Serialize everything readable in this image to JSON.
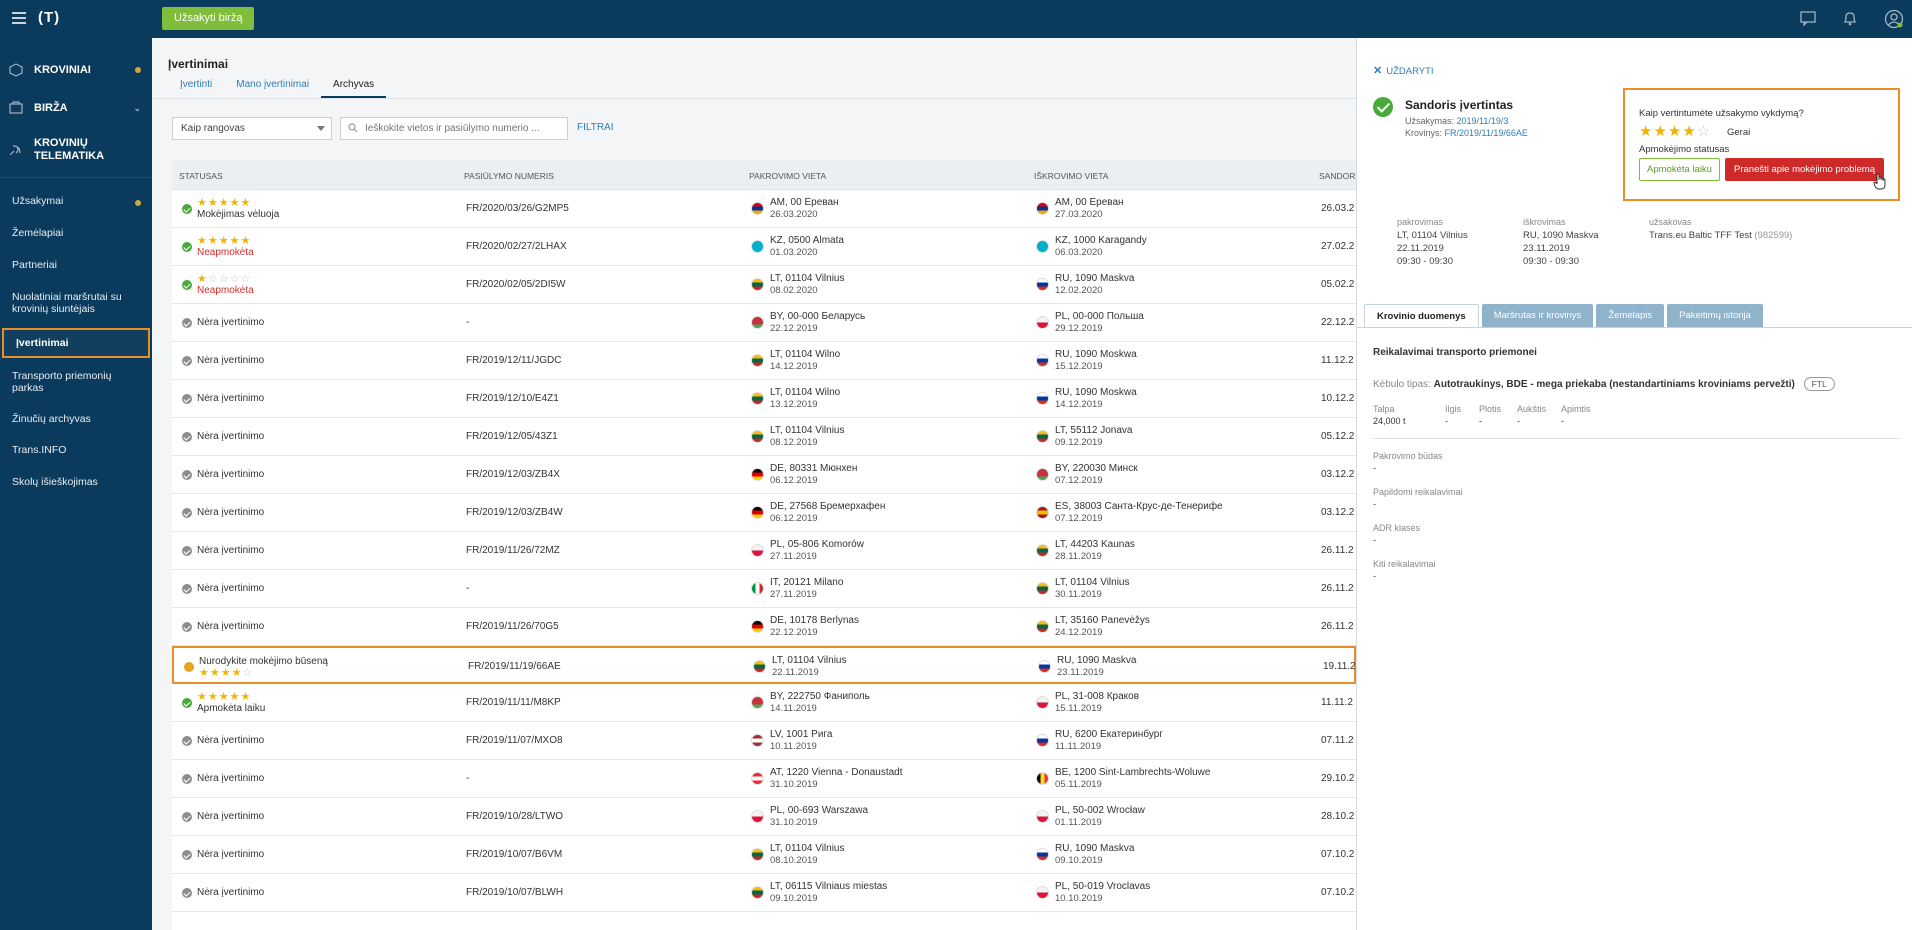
{
  "topbar": {
    "logo": "(T)",
    "order_button": "Užsakyti biržą"
  },
  "sidebar": {
    "main_items": [
      {
        "label": "KROVINIAI",
        "icon": "cargo-icon",
        "badge": true
      },
      {
        "label": "BIRŽA",
        "icon": "exchange-icon",
        "expand": true
      },
      {
        "label": "KROVINIŲ TELEMATIKA",
        "icon": "telematics-icon"
      }
    ],
    "items": [
      {
        "label": "Užsakymai",
        "badge": true
      },
      {
        "label": "Žemėlapiai"
      },
      {
        "label": "Partneriai"
      },
      {
        "label": "Nuolatiniai maršrutai su krovinių siuntėjais"
      },
      {
        "label": "Įvertinimai",
        "active": true
      },
      {
        "label": "Transporto priemonių parkas"
      },
      {
        "label": "Žinučių archyvas"
      },
      {
        "label": "Trans.INFO"
      },
      {
        "label": "Skolų išieškojimas"
      }
    ]
  },
  "main": {
    "title": "Įvertinimai",
    "tabs": [
      "Įvertinti",
      "Mano įvertinimai",
      "Archyvas"
    ],
    "active_tab": 2,
    "role_select": "Kaip rangovas",
    "search_placeholder": "Ieškokite vietos ir pasiūlymo numerio ...",
    "filters_label": "FILTRAI",
    "columns": [
      "STATUSAS",
      "PASIŪLYMO NUMERIS",
      "PAKROVIMO VIETA",
      "IŠKROVIMO VIETA",
      "SANDORI"
    ],
    "rows": [
      {
        "icon": "green",
        "stars": 5,
        "status": "Mokėjimas vėluoja",
        "status_red": false,
        "offer": "FR/2020/03/26/G2MP5",
        "load_place": "AM, 00 Ереван",
        "load_date": "26.03.2020",
        "load_flag": "am",
        "unload_place": "AM, 00 Ереван",
        "unload_date": "27.03.2020",
        "unload_flag": "am",
        "deal": "26.03.2"
      },
      {
        "icon": "green",
        "stars": 5,
        "status": "Neapmokėta",
        "status_red": true,
        "offer": "FR/2020/02/27/2LHAX",
        "load_place": "KZ, 0500 Almata",
        "load_date": "01.03.2020",
        "load_flag": "kz",
        "unload_place": "KZ, 1000 Karagandy",
        "unload_date": "06.03.2020",
        "unload_flag": "kz",
        "deal": "27.02.2"
      },
      {
        "icon": "green",
        "stars": 1,
        "status": "Neapmokėta",
        "status_red": true,
        "offer": "FR/2020/02/05/2DI5W",
        "load_place": "LT, 01104 Vilnius",
        "load_date": "08.02.2020",
        "load_flag": "lt",
        "unload_place": "RU, 1090 Maskva",
        "unload_date": "12.02.2020",
        "unload_flag": "ru",
        "deal": "05.02.2"
      },
      {
        "icon": "grey",
        "stars": 0,
        "status": "Nėra įvertinimo",
        "status_red": false,
        "offer": "-",
        "load_place": "BY, 00-000 Беларусь",
        "load_date": "22.12.2019",
        "load_flag": "by",
        "unload_place": "PL, 00-000 Польша",
        "unload_date": "29.12.2019",
        "unload_flag": "pl",
        "deal": "22.12.2"
      },
      {
        "icon": "grey",
        "stars": 0,
        "status": "Nėra įvertinimo",
        "status_red": false,
        "offer": "FR/2019/12/11/JGDC",
        "load_place": "LT, 01104 Wilno",
        "load_date": "14.12.2019",
        "load_flag": "lt",
        "unload_place": "RU, 1090 Moskwa",
        "unload_date": "15.12.2019",
        "unload_flag": "ru",
        "deal": "11.12.2"
      },
      {
        "icon": "grey",
        "stars": 0,
        "status": "Nėra įvertinimo",
        "status_red": false,
        "offer": "FR/2019/12/10/E4Z1",
        "load_place": "LT, 01104 Wilno",
        "load_date": "13.12.2019",
        "load_flag": "lt",
        "unload_place": "RU, 1090 Moskwa",
        "unload_date": "14.12.2019",
        "unload_flag": "ru",
        "deal": "10.12.2"
      },
      {
        "icon": "grey",
        "stars": 0,
        "status": "Nėra įvertinimo",
        "status_red": false,
        "offer": "FR/2019/12/05/43Z1",
        "load_place": "LT, 01104 Vilnius",
        "load_date": "08.12.2019",
        "load_flag": "lt",
        "unload_place": "LT, 55112 Jonava",
        "unload_date": "09.12.2019",
        "unload_flag": "lt",
        "deal": "05.12.2"
      },
      {
        "icon": "grey",
        "stars": 0,
        "status": "Nėra įvertinimo",
        "status_red": false,
        "offer": "FR/2019/12/03/ZB4X",
        "load_place": "DE, 80331 Мюнхен",
        "load_date": "06.12.2019",
        "load_flag": "de",
        "unload_place": "BY, 220030 Минск",
        "unload_date": "07.12.2019",
        "unload_flag": "by",
        "deal": "03.12.2"
      },
      {
        "icon": "grey",
        "stars": 0,
        "status": "Nėra įvertinimo",
        "status_red": false,
        "offer": "FR/2019/12/03/ZB4W",
        "load_place": "DE, 27568 Бремерхафен",
        "load_date": "06.12.2019",
        "load_flag": "de",
        "unload_place": "ES, 38003 Санта-Крус-де-Тенерифе",
        "unload_date": "07.12.2019",
        "unload_flag": "es",
        "deal": "03.12.2"
      },
      {
        "icon": "grey",
        "stars": 0,
        "status": "Nėra įvertinimo",
        "status_red": false,
        "offer": "FR/2019/11/26/72MZ",
        "load_place": "PL, 05-806 Komorów",
        "load_date": "27.11.2019",
        "load_flag": "pl",
        "unload_place": "LT, 44203 Kaunas",
        "unload_date": "28.11.2019",
        "unload_flag": "lt",
        "deal": "26.11.2"
      },
      {
        "icon": "grey",
        "stars": 0,
        "status": "Nėra įvertinimo",
        "status_red": false,
        "offer": "-",
        "load_place": "IT, 20121 Milano",
        "load_date": "27.11.2019",
        "load_flag": "it",
        "unload_place": "LT, 01104 Vilnius",
        "unload_date": "30.11.2019",
        "unload_flag": "lt",
        "deal": "26.11.2"
      },
      {
        "icon": "grey",
        "stars": 0,
        "status": "Nėra įvertinimo",
        "status_red": false,
        "offer": "FR/2019/11/26/70G5",
        "load_place": "DE, 10178 Berlynas",
        "load_date": "22.12.2019",
        "load_flag": "de",
        "unload_place": "LT, 35160 Panevėžys",
        "unload_date": "24.12.2019",
        "unload_flag": "lt",
        "deal": "26.11.2"
      },
      {
        "icon": "amber",
        "stars": 4,
        "stars_below": true,
        "status": "Nurodykite mokėjimo būseną",
        "status_red": false,
        "offer": "FR/2019/11/19/66AE",
        "load_place": "LT, 01104 Vilnius",
        "load_date": "22.11.2019",
        "load_flag": "lt",
        "unload_place": "RU, 1090 Maskva",
        "unload_date": "23.11.2019",
        "unload_flag": "ru",
        "deal": "19.11.2",
        "highlight": true
      },
      {
        "icon": "green",
        "stars": 5,
        "status": "Apmokėta laiku",
        "status_red": false,
        "offer": "FR/2019/11/11/M8KP",
        "load_place": "BY, 222750 Фаниполь",
        "load_date": "14.11.2019",
        "load_flag": "by",
        "unload_place": "PL, 31-008 Краков",
        "unload_date": "15.11.2019",
        "unload_flag": "pl",
        "deal": "11.11.2"
      },
      {
        "icon": "grey",
        "stars": 0,
        "status": "Nėra įvertinimo",
        "status_red": false,
        "offer": "FR/2019/11/07/MXO8",
        "load_place": "LV, 1001 Рига",
        "load_date": "10.11.2019",
        "load_flag": "lv",
        "unload_place": "RU, 6200 Екатеринбург",
        "unload_date": "11.11.2019",
        "unload_flag": "ru",
        "deal": "07.11.2"
      },
      {
        "icon": "grey",
        "stars": 0,
        "status": "Nėra įvertinimo",
        "status_red": false,
        "offer": "-",
        "load_place": "AT, 1220 Vienna - Donaustadt",
        "load_date": "31.10.2019",
        "load_flag": "at",
        "unload_place": "BE, 1200 Sint-Lambrechts-Woluwe",
        "unload_date": "05.11.2019",
        "unload_flag": "be",
        "deal": "29.10.2"
      },
      {
        "icon": "grey",
        "stars": 0,
        "status": "Nėra įvertinimo",
        "status_red": false,
        "offer": "FR/2019/10/28/LTWO",
        "load_place": "PL, 00-693 Warszawa",
        "load_date": "31.10.2019",
        "load_flag": "pl",
        "unload_place": "PL, 50-002 Wrocław",
        "unload_date": "01.11.2019",
        "unload_flag": "pl",
        "deal": "28.10.2"
      },
      {
        "icon": "grey",
        "stars": 0,
        "status": "Nėra įvertinimo",
        "status_red": false,
        "offer": "FR/2019/10/07/B6VM",
        "load_place": "LT, 01104 Vilnius",
        "load_date": "08.10.2019",
        "load_flag": "lt",
        "unload_place": "RU, 1090 Maskva",
        "unload_date": "09.10.2019",
        "unload_flag": "ru",
        "deal": "07.10.2"
      },
      {
        "icon": "grey",
        "stars": 0,
        "status": "Nėra įvertinimo",
        "status_red": false,
        "offer": "FR/2019/10/07/BLWH",
        "load_place": "LT, 06115 Vilniaus miestas",
        "load_date": "09.10.2019",
        "load_flag": "lt",
        "unload_place": "PL, 50-019 Vroclavas",
        "unload_date": "10.10.2019",
        "unload_flag": "pl",
        "deal": "07.10.2"
      }
    ]
  },
  "panel": {
    "close_label": "UŽDARYTI",
    "deal_title": "Sandoris įvertintas",
    "order_label": "Užsakymas:",
    "order_value": "2019/11/19/3",
    "cargo_label": "Krovinys:",
    "cargo_value": "FR/2019/11/19/66AE",
    "rating_question": "Kaip vertintumėte užsakymo vykdymą?",
    "rating_stars": 4,
    "rating_word": "Gerai",
    "payment_status_label": "Apmokėjimo statusas",
    "paid_button": "Apmokėta laiku",
    "report_button": "Pranešti apie mokėjimo problemą",
    "loading": {
      "label": "pakrovimas",
      "place": "LT, 01104 Vilnius",
      "date": "22.11.2019",
      "time": "09:30 - 09:30"
    },
    "unloading": {
      "label": "iškrovimas",
      "place": "RU, 1090 Maskva",
      "date": "23.11.2019",
      "time": "09:30 - 09:30"
    },
    "customer": {
      "label": "užsakovas",
      "name": "Trans.eu Baltic TFF Test",
      "id": "(982599)"
    },
    "tabs": [
      "Krovinio duomenys",
      "Maršrutas ir krovinys",
      "Žemėlapis",
      "Pakeitimų istorija"
    ],
    "section_title": "Reikalavimai transporto priemonei",
    "body_type_label": "Kėbulo tipas:",
    "body_type_value": "Autotraukinys, BDE - mega priekaba (nestandartiniams kroviniams pervežti)",
    "ftl": "FTL",
    "dims": [
      {
        "label": "Talpa",
        "value": "24,000 t"
      },
      {
        "label": "Ilgis",
        "value": "-"
      },
      {
        "label": "Plotis",
        "value": "-"
      },
      {
        "label": "Aukštis",
        "value": "-"
      },
      {
        "label": "Apimtis",
        "value": "-"
      }
    ],
    "requirements": [
      {
        "label": "Pakrovimo būdas",
        "value": "-"
      },
      {
        "label": "Papildomi reikalavimai",
        "value": "-"
      },
      {
        "label": "ADR klasės",
        "value": "-"
      },
      {
        "label": "Kiti reikalavimai",
        "value": "-"
      }
    ]
  }
}
